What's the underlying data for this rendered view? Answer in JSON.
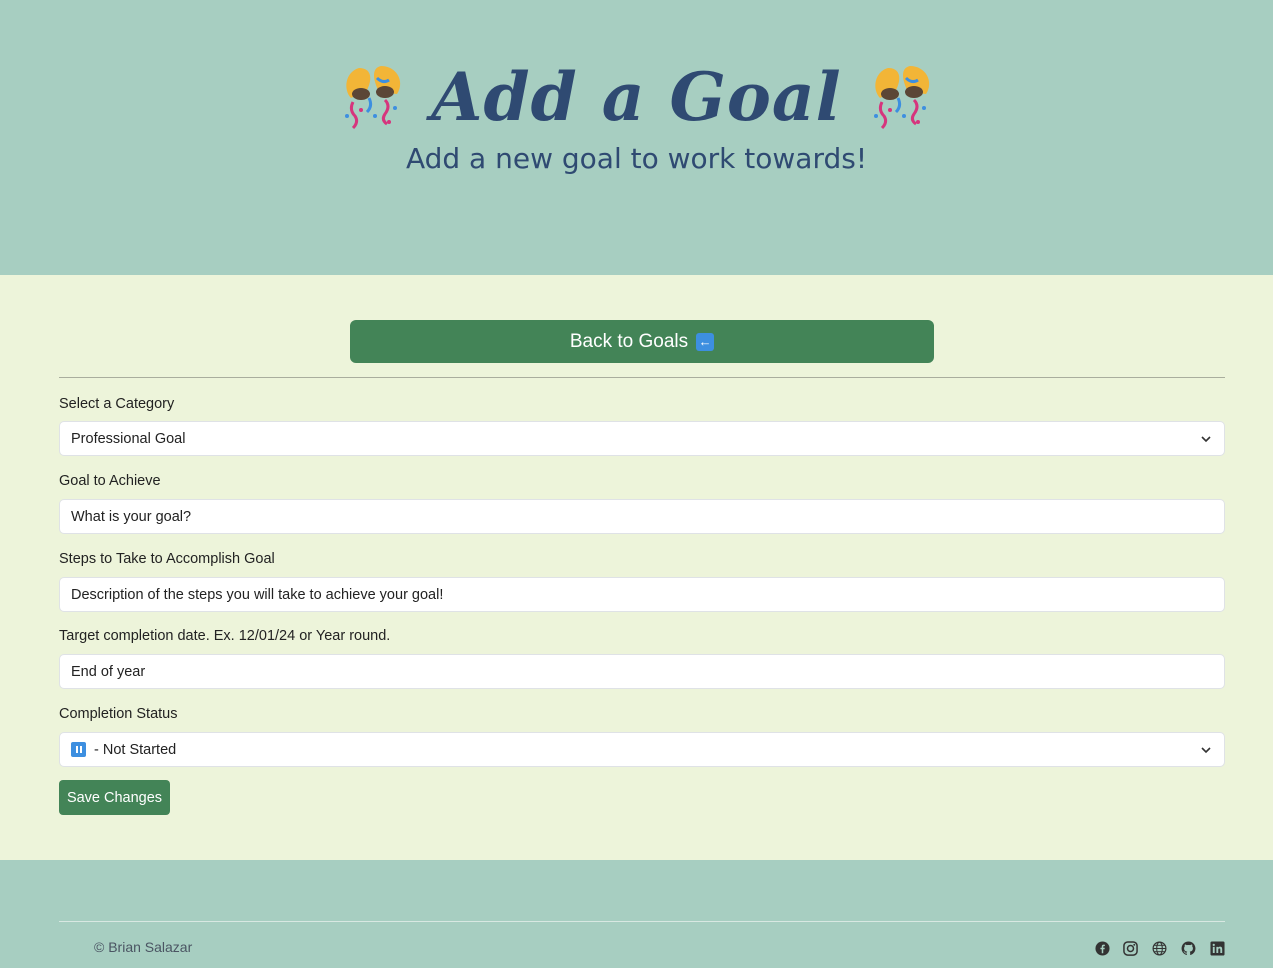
{
  "header": {
    "title": "Add a Goal",
    "subtitle": "Add a new goal to work towards!",
    "decoration_icon": "party-popper-icon"
  },
  "nav": {
    "back_label": "Back to Goals",
    "back_icon": "left-arrow-icon"
  },
  "form": {
    "category": {
      "label": "Select a Category",
      "value": "Professional Goal"
    },
    "goal": {
      "label": "Goal to Achieve",
      "placeholder": "What is your goal?"
    },
    "steps": {
      "label": "Steps to Take to Accomplish Goal",
      "placeholder": "Description of the steps you will take to achieve your goal!"
    },
    "target_date": {
      "label": "Target completion date. Ex. 12/01/24 or Year round.",
      "value": "End of year"
    },
    "status": {
      "label": "Completion Status",
      "value": "- Not Started",
      "icon": "pause-icon"
    },
    "save_label": "Save Changes"
  },
  "footer": {
    "copyright": "© Brian Salazar",
    "social_icons": [
      "facebook-icon",
      "instagram-icon",
      "globe-icon",
      "github-icon",
      "linkedin-icon"
    ]
  },
  "colors": {
    "hero_bg": "#a7cec1",
    "main_bg": "#edf4da",
    "heading": "#2f4a72",
    "button": "#438457"
  }
}
